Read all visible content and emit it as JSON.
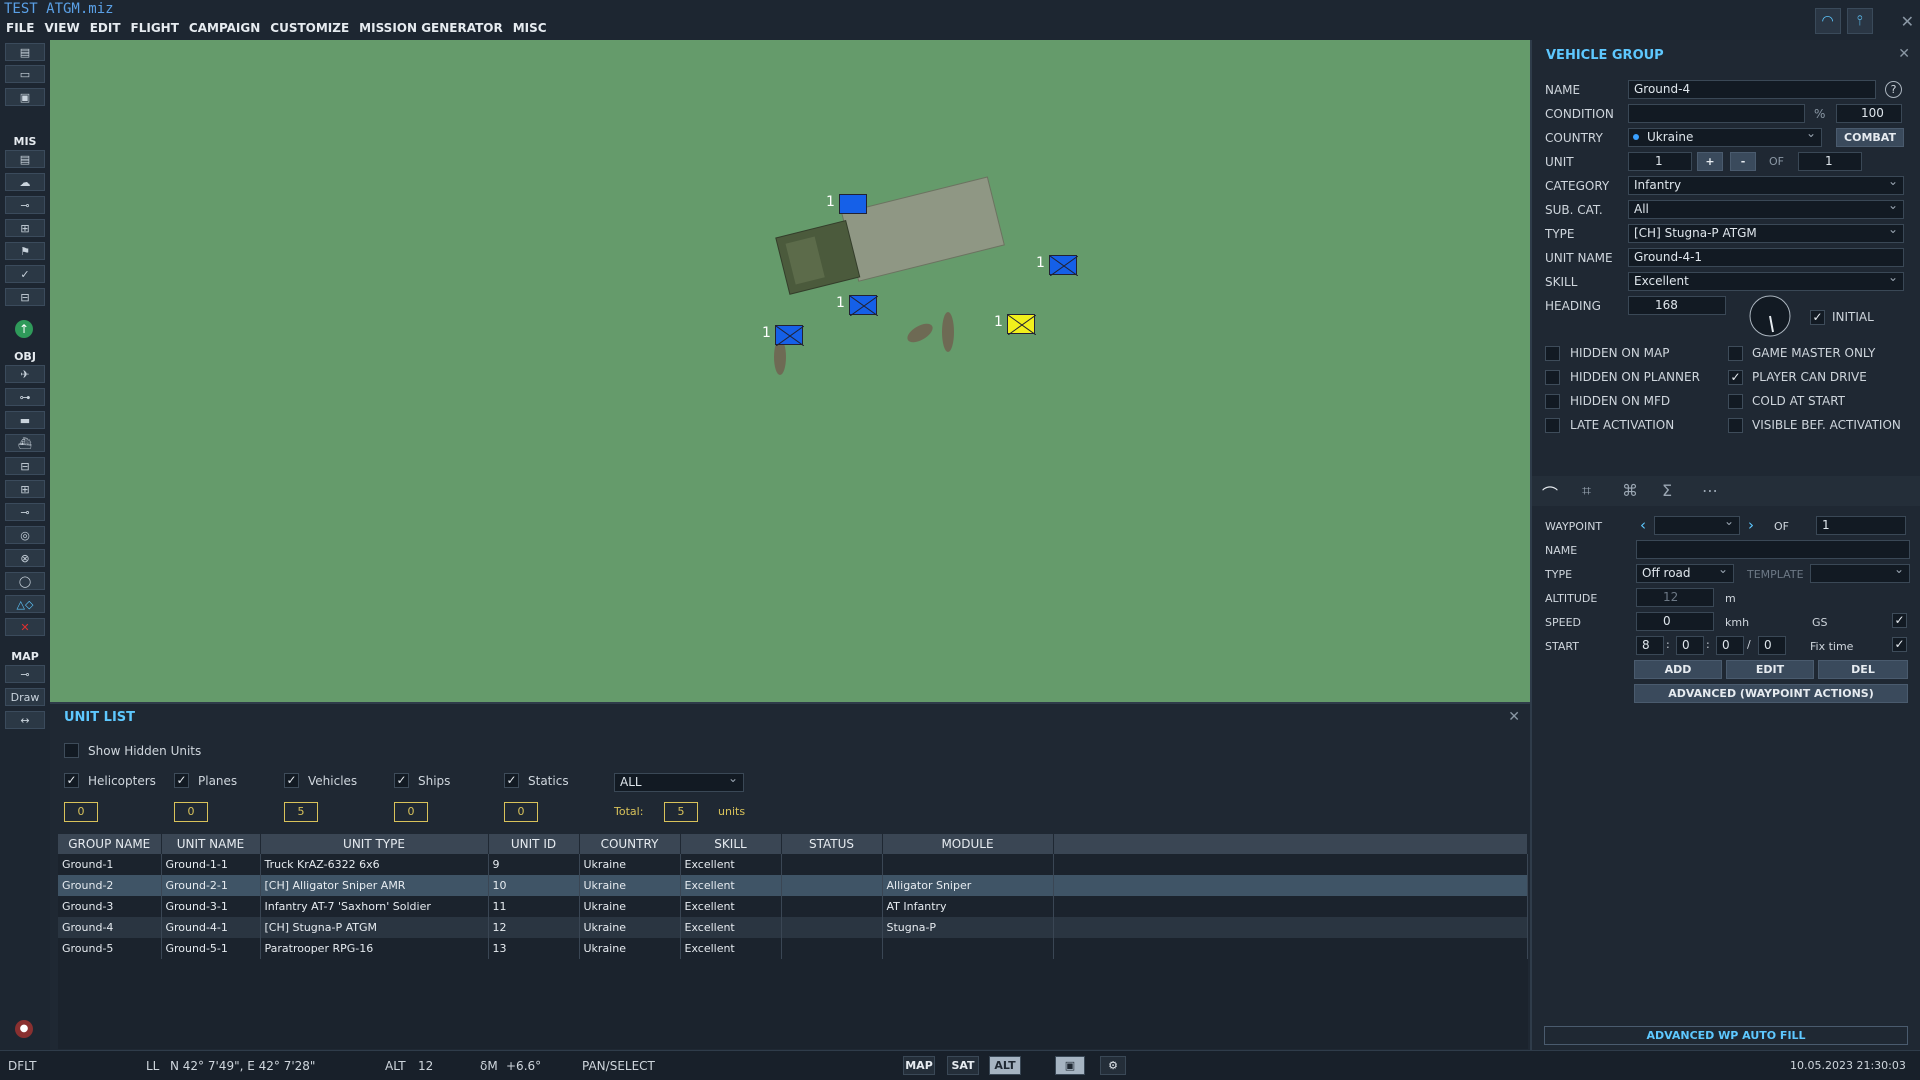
{
  "app": {
    "title": "TEST ATGM.miz"
  },
  "menu": [
    "FILE",
    "VIEW",
    "EDIT",
    "FLIGHT",
    "CAMPAIGN",
    "CUSTOMIZE",
    "MISSION GENERATOR",
    "MISC"
  ],
  "toolbar": {
    "mis_label": "MIS",
    "obj_label": "OBJ",
    "map_label": "MAP",
    "draw_label": "Draw"
  },
  "map": {
    "markers": [
      {
        "label": "1",
        "color": "blue",
        "kind": "rect"
      },
      {
        "label": "1",
        "color": "blue",
        "kind": "cross"
      },
      {
        "label": "1",
        "color": "blue",
        "kind": "cross"
      },
      {
        "label": "1",
        "color": "blue",
        "kind": "cross"
      },
      {
        "label": "1",
        "color": "yellow",
        "kind": "cross"
      }
    ]
  },
  "vehicle_group": {
    "title": "VEHICLE GROUP",
    "name_label": "NAME",
    "name_value": "Ground-4",
    "help": "?",
    "condition_label": "CONDITION",
    "condition_pct": "%",
    "condition_value": "100",
    "country_label": "COUNTRY",
    "country_value": "Ukraine",
    "combat_button": "COMBAT",
    "unit_label": "UNIT",
    "unit_value": "1",
    "plus": "+",
    "minus": "-",
    "of_label": "OF",
    "unit_of": "1",
    "category_label": "CATEGORY",
    "category_value": "Infantry",
    "subcat_label": "SUB. CAT.",
    "subcat_value": "All",
    "type_label": "TYPE",
    "type_value": "[CH] Stugna-P ATGM",
    "unitname_label": "UNIT NAME",
    "unitname_value": "Ground-4-1",
    "skill_label": "SKILL",
    "skill_value": "Excellent",
    "heading_label": "HEADING",
    "heading_value": "168",
    "initial_label": "INITIAL",
    "checks": [
      {
        "label": "HIDDEN ON MAP",
        "checked": false
      },
      {
        "label": "GAME MASTER ONLY",
        "checked": false
      },
      {
        "label": "HIDDEN ON PLANNER",
        "checked": false
      },
      {
        "label": "PLAYER CAN DRIVE",
        "checked": true
      },
      {
        "label": "HIDDEN ON MFD",
        "checked": false
      },
      {
        "label": "COLD AT START",
        "checked": false
      },
      {
        "label": "LATE ACTIVATION",
        "checked": false
      },
      {
        "label": "VISIBLE BEF. ACTIVATION",
        "checked": false
      }
    ]
  },
  "waypoint": {
    "waypoint_label": "WAYPOINT",
    "of_label": "OF",
    "of_value": "1",
    "name_label": "NAME",
    "type_label": "TYPE",
    "type_value": "Off road",
    "template_label": "TEMPLATE",
    "altitude_label": "ALTITUDE",
    "altitude_value": "12",
    "altitude_unit": "m",
    "speed_label": "SPEED",
    "speed_value": "0",
    "speed_unit": "kmh",
    "gs_label": "GS",
    "start_label": "START",
    "start_h": "8",
    "start_m": "0",
    "start_s": "0",
    "start_d": "0",
    "fixtime_label": "Fix time",
    "add": "ADD",
    "edit": "EDIT",
    "del": "DEL",
    "advanced": "ADVANCED (WAYPOINT ACTIONS)",
    "autofill": "ADVANCED WP AUTO FILL"
  },
  "unit_list": {
    "title": "UNIT LIST",
    "show_hidden": "Show Hidden Units",
    "filters": [
      {
        "label": "Helicopters",
        "count": "0"
      },
      {
        "label": "Planes",
        "count": "0"
      },
      {
        "label": "Vehicles",
        "count": "5"
      },
      {
        "label": "Ships",
        "count": "0"
      },
      {
        "label": "Statics",
        "count": "0"
      }
    ],
    "coalition": "ALL",
    "total_label": "Total:",
    "total_value": "5",
    "units_label": "units",
    "columns": [
      "GROUP NAME",
      "UNIT NAME",
      "UNIT TYPE",
      "UNIT ID",
      "COUNTRY",
      "SKILL",
      "STATUS",
      "MODULE"
    ],
    "rows": [
      [
        "Ground-1",
        "Ground-1-1",
        "Truck KrAZ-6322 6x6",
        "9",
        "Ukraine",
        "Excellent",
        "",
        ""
      ],
      [
        "Ground-2",
        "Ground-2-1",
        "[CH] Alligator Sniper AMR",
        "10",
        "Ukraine",
        "Excellent",
        "",
        "Alligator Sniper"
      ],
      [
        "Ground-3",
        "Ground-3-1",
        "Infantry AT-7 'Saxhorn' Soldier",
        "11",
        "Ukraine",
        "Excellent",
        "",
        "AT Infantry"
      ],
      [
        "Ground-4",
        "Ground-4-1",
        "[CH] Stugna-P ATGM",
        "12",
        "Ukraine",
        "Excellent",
        "",
        "Stugna-P"
      ],
      [
        "Ground-5",
        "Ground-5-1",
        "Paratrooper RPG-16",
        "13",
        "Ukraine",
        "Excellent",
        "",
        ""
      ]
    ]
  },
  "status": {
    "dflt": "DFLT",
    "ll_label": "LL",
    "coords": "N 42° 7'49\", E 42° 7'28\"",
    "alt_label": "ALT",
    "alt_value": "12",
    "mag": "δM",
    "mag_value": "+6.6°",
    "mode": "PAN/SELECT",
    "btn_map": "MAP",
    "btn_sat": "SAT",
    "btn_alt": "ALT",
    "datetime": "10.05.2023 21:30:03"
  }
}
